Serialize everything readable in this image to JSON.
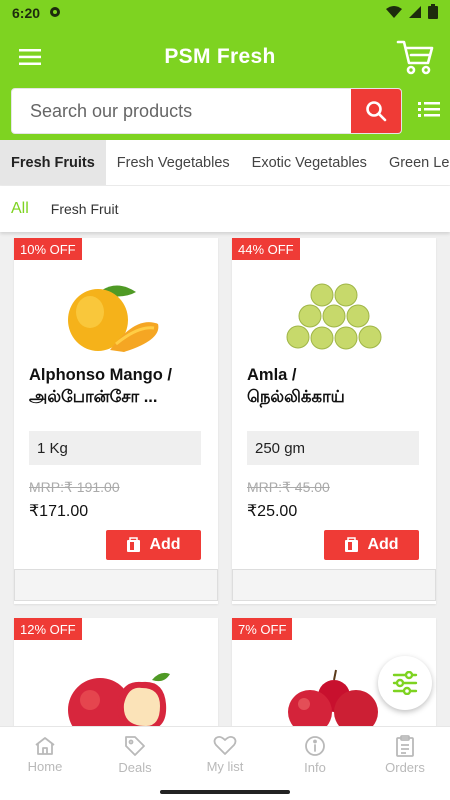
{
  "status_bar": {
    "time": "6:20"
  },
  "app": {
    "title": "PSM Fresh"
  },
  "search": {
    "placeholder": "Search our products"
  },
  "category_tabs": [
    {
      "label": "Fresh Fruits",
      "active": true
    },
    {
      "label": "Fresh Vegetables",
      "active": false
    },
    {
      "label": "Exotic Vegetables",
      "active": false
    },
    {
      "label": "Green Le",
      "active": false
    }
  ],
  "sub_tabs": [
    {
      "label": "All",
      "active": true
    },
    {
      "label": "Fresh Fruit",
      "active": false
    }
  ],
  "products": [
    {
      "discount": "10% OFF",
      "name_line1": "Alphonso Mango /",
      "name_line2": "அல்போன்சோ ...",
      "quantity": "1 Kg",
      "mrp": "MRP:₹ 191.00",
      "price": "₹171.00",
      "add_label": "Add",
      "image": "mango"
    },
    {
      "discount": "44% OFF",
      "name_line1": "Amla /",
      "name_line2": "நெல்லிக்காய்",
      "quantity": "250 gm",
      "mrp": "MRP:₹ 45.00",
      "price": "₹25.00",
      "add_label": "Add",
      "image": "amla"
    },
    {
      "discount": "12% OFF",
      "image": "apple"
    },
    {
      "discount": "7% OFF",
      "image": "apples"
    }
  ],
  "bottom_nav": [
    {
      "label": "Home",
      "icon": "home-icon"
    },
    {
      "label": "Deals",
      "icon": "tag-icon"
    },
    {
      "label": "My list",
      "icon": "heart-icon"
    },
    {
      "label": "Info",
      "icon": "info-icon"
    },
    {
      "label": "Orders",
      "icon": "clipboard-icon"
    }
  ],
  "colors": {
    "brand_green": "#7ed321",
    "accent_red": "#ef3b36"
  }
}
